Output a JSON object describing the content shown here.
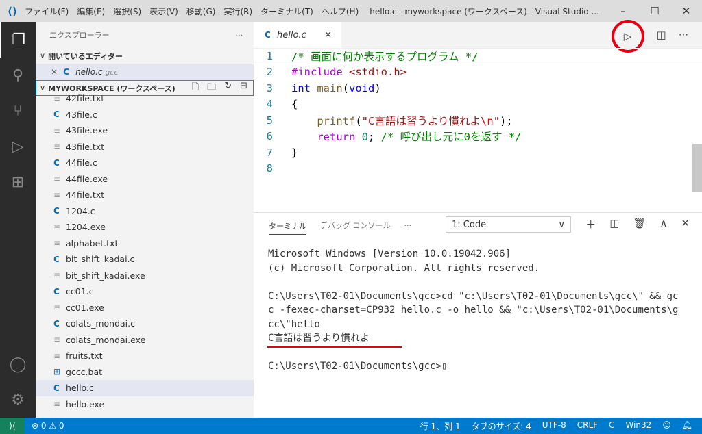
{
  "titlebar": {
    "menus": [
      "ファイル(F)",
      "編集(E)",
      "選択(S)",
      "表示(V)",
      "移動(G)",
      "実行(R)",
      "ターミナル(T)",
      "ヘルプ(H)"
    ],
    "title": "hello.c - myworkspace (ワークスペース) - Visual Studio ..."
  },
  "sidebar": {
    "title": "エクスプローラー",
    "open_editors": "開いているエディター",
    "open_file": "hello.c",
    "open_file_folder": "gcc",
    "workspace": "MYWORKSPACE (ワークスペース)",
    "files": [
      {
        "name": "42file.txt",
        "type": "t"
      },
      {
        "name": "43file.c",
        "type": "c"
      },
      {
        "name": "43file.exe",
        "type": "t"
      },
      {
        "name": "43file.txt",
        "type": "t"
      },
      {
        "name": "44file.c",
        "type": "c"
      },
      {
        "name": "44file.exe",
        "type": "t"
      },
      {
        "name": "44file.txt",
        "type": "t"
      },
      {
        "name": "1204.c",
        "type": "c"
      },
      {
        "name": "1204.exe",
        "type": "t"
      },
      {
        "name": "alphabet.txt",
        "type": "t"
      },
      {
        "name": "bit_shift_kadai.c",
        "type": "c"
      },
      {
        "name": "bit_shift_kadai.exe",
        "type": "t"
      },
      {
        "name": "cc01.c",
        "type": "c"
      },
      {
        "name": "cc01.exe",
        "type": "t"
      },
      {
        "name": "colats_mondai.c",
        "type": "c"
      },
      {
        "name": "colats_mondai.exe",
        "type": "t"
      },
      {
        "name": "fruits.txt",
        "type": "t"
      },
      {
        "name": "gccc.bat",
        "type": "b"
      },
      {
        "name": "hello.c",
        "type": "c",
        "selected": true
      },
      {
        "name": "hello.exe",
        "type": "t"
      }
    ]
  },
  "tab": {
    "label": "hello.c"
  },
  "code": [
    [
      [
        "cm",
        "/* 画面に何か表示するプログラム */"
      ]
    ],
    [
      [
        "pp",
        "#include "
      ],
      [
        "str",
        "<stdio.h>"
      ]
    ],
    [
      [
        "kw",
        "int "
      ],
      [
        "fn",
        "main"
      ],
      [
        "pl",
        "("
      ],
      [
        "kw",
        "void"
      ],
      [
        "pl",
        ")"
      ]
    ],
    [
      [
        "pl",
        "{"
      ]
    ],
    [
      [
        "pl",
        "    "
      ],
      [
        "fn",
        "printf"
      ],
      [
        "pl",
        "("
      ],
      [
        "str",
        "\"C言語は習うより慣れよ"
      ],
      [
        "esc",
        "\\n"
      ],
      [
        "str",
        "\""
      ],
      [
        "pl",
        ");"
      ]
    ],
    [
      [
        "pl",
        "    "
      ],
      [
        "pp",
        "return "
      ],
      [
        "num",
        "0"
      ],
      [
        "pl",
        "; "
      ],
      [
        "cm",
        "/* 呼び出し元に0を返す */"
      ]
    ],
    [
      [
        "pl",
        "}"
      ]
    ],
    []
  ],
  "panel": {
    "tab_terminal": "ターミナル",
    "tab_debug": "デバッグ コンソール",
    "terminal_select": "1: Code",
    "output": "Microsoft Windows [Version 10.0.19042.906]\n(c) Microsoft Corporation. All rights reserved.\n\nC:\\Users\\T02-01\\Documents\\gcc>cd \"c:\\Users\\T02-01\\Documents\\gcc\\\" && gc\nc -fexec-charset=CP932 hello.c -o hello && \"c:\\Users\\T02-01\\Documents\\g\ncc\\\"hello\nC言語は習うより慣れよ\n\nC:\\Users\\T02-01\\Documents\\gcc>▯"
  },
  "status": {
    "problems": "⊗ 0 ⚠ 0",
    "position": "行 1、列 1",
    "tabsize": "タブのサイズ: 4",
    "encoding": "UTF-8",
    "eol": "CRLF",
    "language": "C",
    "platform": "Win32"
  }
}
